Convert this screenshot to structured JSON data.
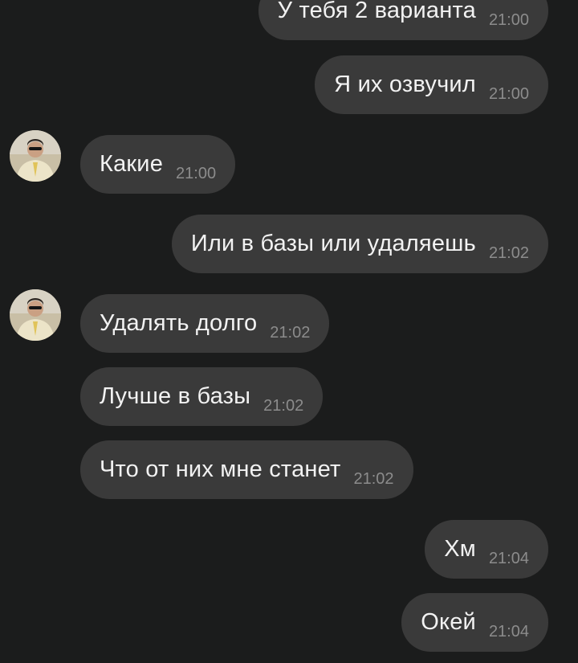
{
  "messages": [
    {
      "text": "У тебя 2 варианта",
      "time": "21:00",
      "side": "out"
    },
    {
      "text": "Я их озвучил",
      "time": "21:00",
      "side": "out"
    },
    {
      "text": "Какие",
      "time": "21:00",
      "side": "in",
      "avatar": "user-avatar"
    },
    {
      "text": "Или в базы или удаляешь",
      "time": "21:02",
      "side": "out"
    },
    {
      "text": "Удалять долго",
      "time": "21:02",
      "side": "in",
      "avatar": "user-avatar"
    },
    {
      "text": "Лучше в базы",
      "time": "21:02",
      "side": "in"
    },
    {
      "text": "Что от них мне станет",
      "time": "21:02",
      "side": "in"
    },
    {
      "text": "Хм",
      "time": "21:04",
      "side": "out"
    },
    {
      "text": "Окей",
      "time": "21:04",
      "side": "out"
    }
  ],
  "colors": {
    "background": "#1b1c1c",
    "bubble": "#3a3a3a",
    "message_text": "#f2f2f2",
    "timestamp": "#8c8c8c"
  }
}
